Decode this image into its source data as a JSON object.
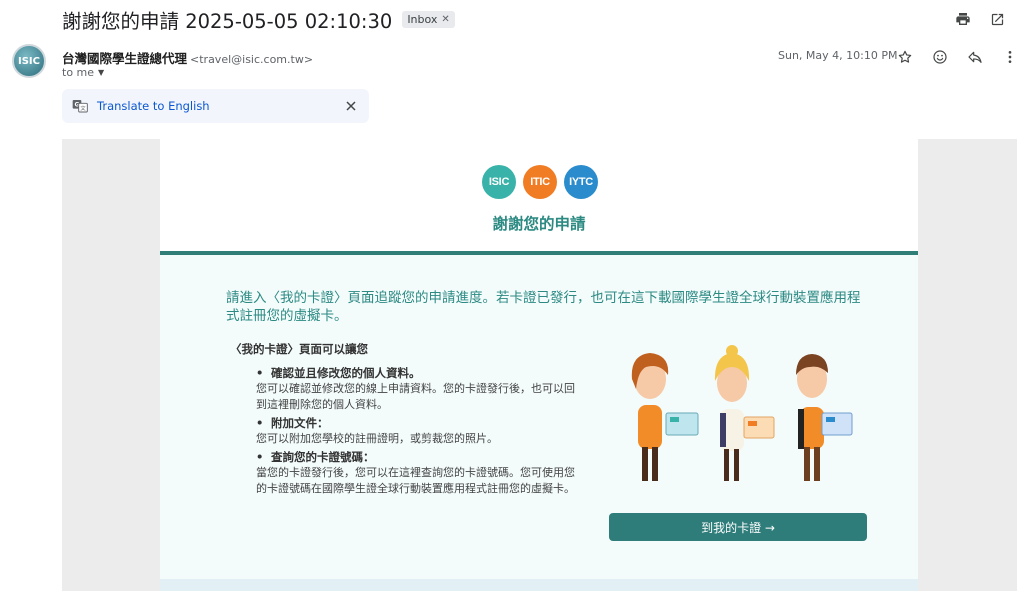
{
  "subject": "謝謝您的申請 2025-05-05 02:10:30",
  "label": {
    "name": "Inbox",
    "remove_icon": "close-icon"
  },
  "top_actions": [
    "print-icon",
    "open-in-new-window-icon"
  ],
  "sender": {
    "avatar_text": "ISIC",
    "name": "台灣國際學生證總代理",
    "email": "<travel@isic.com.tw>",
    "to": "to me"
  },
  "date": "Sun, May 4, 10:10 PM",
  "message_actions": [
    "star-icon",
    "emoji-icon",
    "reply-icon",
    "more-icon"
  ],
  "translate": {
    "link": "Translate to English"
  },
  "email": {
    "logos": [
      "ISIC",
      "ITIC",
      "IYTC"
    ],
    "title": "謝謝您的申請",
    "intro": "請進入〈我的卡證〉頁面追蹤您的申請進度。若卡證已發行，也可在這下載國際學生證全球行動裝置應用程式註冊您的虛擬卡。",
    "sub_heading": "〈我的卡證〉頁面可以讓您",
    "features": [
      {
        "title": "確認並且修改您的個人資料。",
        "desc": "您可以確認並修改您的線上申請資料。您的卡證發行後，也可以回到這裡刪除您的個人資料。"
      },
      {
        "title": "附加文件：",
        "desc": "您可以附加您學校的註冊證明，或剪裁您的照片。"
      },
      {
        "title": "查詢您的卡證號碼：",
        "desc": "當您的卡證發行後，您可以在這裡查詢您的卡證號碼。您可使用您的卡證號碼在國際學生證全球行動裝置應用程式註冊您的虛擬卡。"
      }
    ],
    "cta": "到我的卡證 →",
    "colors": {
      "accent": "#2c8a83",
      "button": "#2e7d7a",
      "body_bg": "#f3fbfb"
    }
  }
}
